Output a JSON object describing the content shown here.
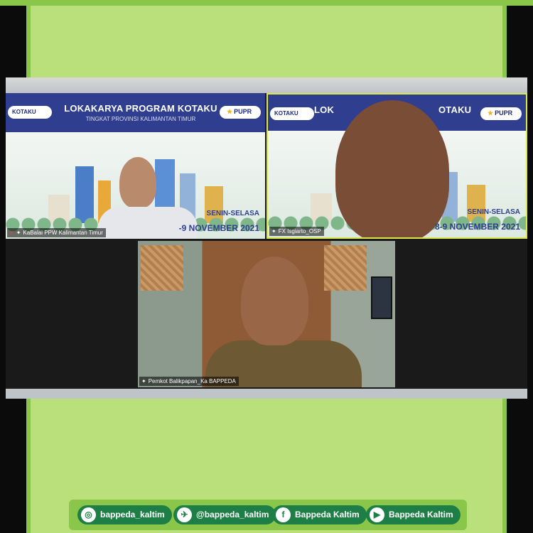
{
  "meeting": {
    "tiles": [
      {
        "banner_title": "LOKAKARYA PROGRAM KOTAKU",
        "banner_subtitle": "TINGKAT PROVINSI KALIMANTAN TIMUR",
        "logo_left": "KOTAKU",
        "logo_right": "PUPR",
        "date_line1": "SENIN-SELASA",
        "date_line2": "-9 NOVEMBER 2021",
        "participant_name": "KaBalai PPW Kalimantan Timur"
      },
      {
        "banner_title": "LOK",
        "banner_title_suffix": "OTAKU",
        "logo_left": "KOTAKU",
        "logo_right": "PUPR",
        "date_line1": "SENIN-SELASA",
        "date_line2": "8-9 NOVEMBER 2021",
        "participant_name": "FX Isgiarto_OSP"
      },
      {
        "participant_name": "Pemkot Balikpapan_Ka BAPPEDA"
      }
    ]
  },
  "social": {
    "items": [
      {
        "icon": "instagram-icon",
        "label": "bappeda_kaltim"
      },
      {
        "icon": "twitter-icon",
        "label": "@bappeda_kaltim"
      },
      {
        "icon": "facebook-icon",
        "label": "Bappeda Kaltim"
      },
      {
        "icon": "youtube-icon",
        "label": "Bappeda Kaltim"
      }
    ]
  },
  "colors": {
    "frame_green": "#8ac64a",
    "background_green": "#b9e07a",
    "banner_blue": "#2f3e8f",
    "chip_green": "#1d7f45",
    "active_speaker_border": "#d9e84a"
  }
}
